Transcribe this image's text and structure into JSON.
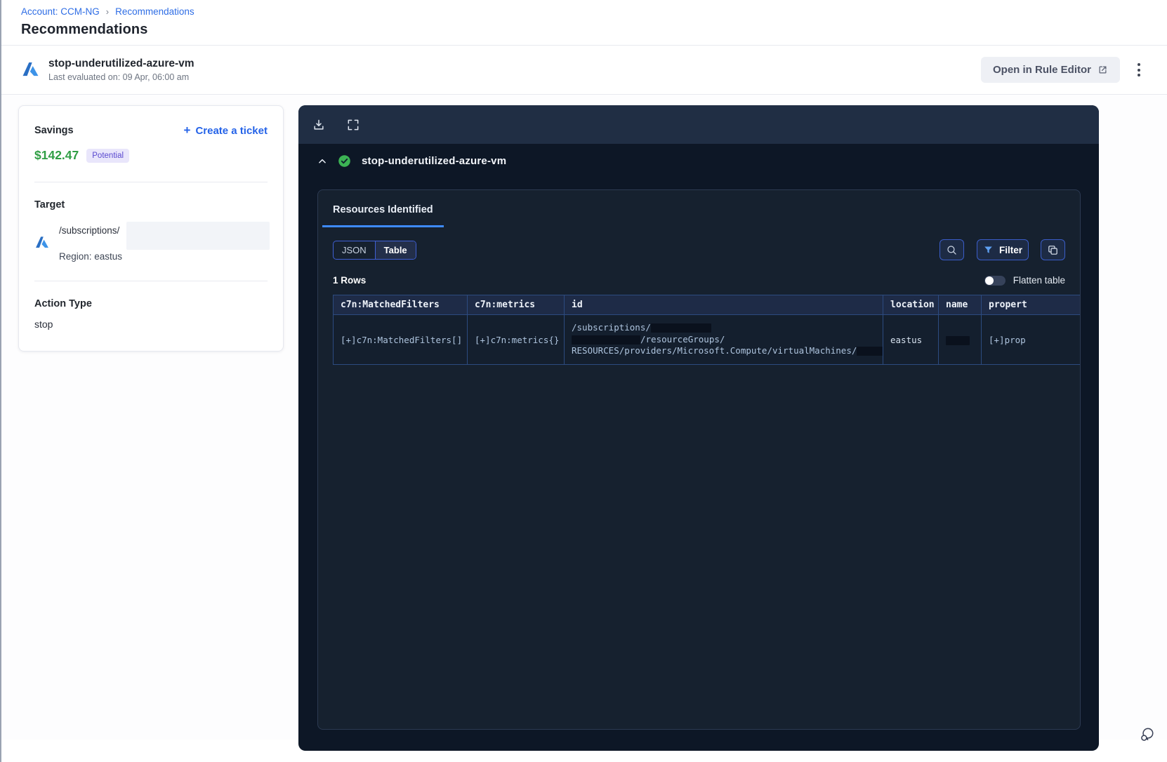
{
  "breadcrumb": {
    "account": "Account: CCM-NG",
    "separator": "›",
    "page": "Recommendations"
  },
  "page_title": "Recommendations",
  "recommendation": {
    "name": "stop-underutilized-azure-vm",
    "last_evaluated": "Last evaluated on: 09 Apr, 06:00 am",
    "open_button": "Open in Rule Editor"
  },
  "savings": {
    "label": "Savings",
    "create_ticket_plus": "+",
    "create_ticket_label": "Create a ticket",
    "amount": "$142.47",
    "badge": "Potential"
  },
  "target": {
    "label": "Target",
    "path": "/subscriptions/",
    "region": "Region: eastus"
  },
  "action": {
    "label": "Action Type",
    "value": "stop"
  },
  "panel": {
    "section_title": "stop-underutilized-azure-vm",
    "tab_label": "Resources Identified",
    "view_json": "JSON",
    "view_table": "Table",
    "filter_label": "Filter",
    "rows_count": "1 Rows",
    "flatten_label": "Flatten table",
    "columns": [
      "c7n:MatchedFilters",
      "c7n:metrics",
      "id",
      "location",
      "name",
      "propert"
    ],
    "row": {
      "matched_filters": "[+]c7n:MatchedFilters[]",
      "metrics": "[+]c7n:metrics{}",
      "id_line1": "/subscriptions/",
      "id_line2": "/resourceGroups/",
      "id_line3": "RESOURCES/providers/Microsoft.Compute/virtualMachines/",
      "location": "eastus",
      "name_value": "",
      "properties": "[+]prop"
    }
  },
  "colors": {
    "link_blue": "#2e6de5",
    "savings_green": "#2f9e44",
    "badge_bg": "#e9e6fb",
    "badge_text": "#5a49cf",
    "panel_bg": "#0d1726",
    "panel_toolbar": "#202e44",
    "inner_card_bg": "#16212f",
    "accent_blue": "#3e8bff",
    "button_border_blue": "#3a5dc8",
    "table_border": "#2c4b80",
    "table_header_bg": "#1e2b47",
    "check_green": "#3cb354",
    "funnel_blue": "#5ea0f2"
  }
}
